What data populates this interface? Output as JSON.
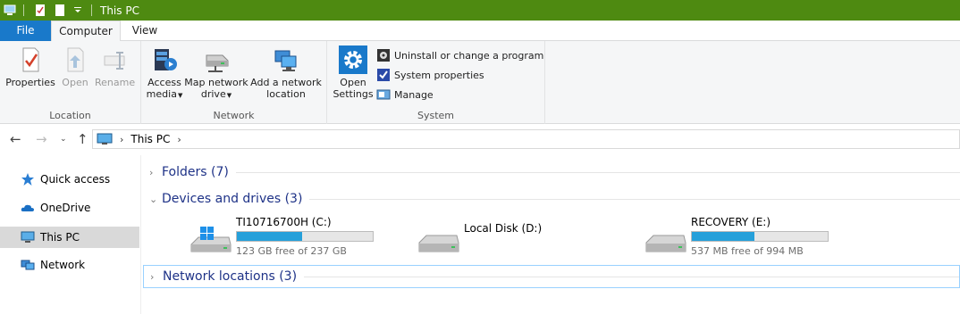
{
  "window": {
    "title": "This PC"
  },
  "ribbon_tabs": {
    "file": "File",
    "computer": "Computer",
    "view": "View"
  },
  "location_group": {
    "label": "Location",
    "properties": "Properties",
    "open": "Open",
    "rename": "Rename"
  },
  "network_group": {
    "label": "Network",
    "access_media_1": "Access",
    "access_media_2": "media",
    "map_drive_1": "Map network",
    "map_drive_2": "drive",
    "add_location_1": "Add a network",
    "add_location_2": "location"
  },
  "system_group": {
    "label": "System",
    "open_settings_1": "Open",
    "open_settings_2": "Settings",
    "uninstall": "Uninstall or change a program",
    "system_properties": "System properties",
    "manage": "Manage"
  },
  "address": {
    "path": "This PC"
  },
  "sidebar": {
    "items": [
      {
        "label": "Quick access",
        "icon": "star-icon"
      },
      {
        "label": "OneDrive",
        "icon": "cloud-icon"
      },
      {
        "label": "This PC",
        "icon": "computer-icon",
        "selected": true
      },
      {
        "label": "Network",
        "icon": "network-icon"
      }
    ]
  },
  "sections": {
    "folders": "Folders (7)",
    "devices": "Devices and drives (3)",
    "network": "Network locations (3)"
  },
  "drives": [
    {
      "name": "TI10716700H (C:)",
      "free": "123 GB free of 237 GB",
      "used_fraction": 0.48,
      "icon": "windows-drive-icon"
    },
    {
      "name": "Local Disk (D:)",
      "free": "",
      "used_fraction": null,
      "icon": "hard-drive-icon"
    },
    {
      "name": "RECOVERY (E:)",
      "free": "537 MB free of 994 MB",
      "used_fraction": 0.46,
      "icon": "hard-drive-icon"
    }
  ],
  "colors": {
    "titlebar": "#4e8a11",
    "file_tab": "#1979ca",
    "drive_bar": "#26a0da",
    "section_title": "#1e3287"
  }
}
